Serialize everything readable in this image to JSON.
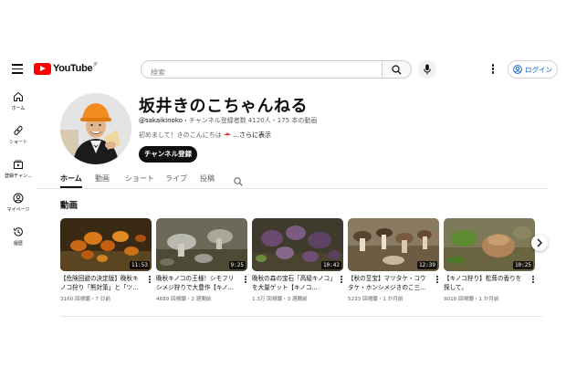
{
  "header": {
    "logo_text": "YouTube",
    "logo_region": "JP",
    "search_placeholder": "検索",
    "login_label": "ログイン"
  },
  "sidebar": {
    "items": [
      {
        "label": "ホーム",
        "icon": "home-icon"
      },
      {
        "label": "ショート",
        "icon": "shorts-icon"
      },
      {
        "label": "登録チャン...",
        "icon": "subscriptions-icon"
      },
      {
        "label": "マイページ",
        "icon": "you-icon"
      },
      {
        "label": "履歴",
        "icon": "history-icon"
      }
    ]
  },
  "channel": {
    "name": "坂井きのこちゃんねる",
    "handle": "@sakaikinoko",
    "meta_rest": "・チャンネル登録者数 4120人・175 本の動画",
    "description": "初めまして！きのこんにちは",
    "description_more": "...さらに表示",
    "subscribe_label": "チャンネル登録"
  },
  "tabs": [
    {
      "label": "ホーム",
      "active": true
    },
    {
      "label": "動画",
      "active": false
    },
    {
      "label": "ショート",
      "active": false
    },
    {
      "label": "ライブ",
      "active": false
    },
    {
      "label": "投稿",
      "active": false
    }
  ],
  "section": {
    "title": "動画"
  },
  "videos": [
    {
      "title": "【危険回避の決定版】晩秋キノコ狩り「熊対策」と「ツ...",
      "duration": "11:53",
      "meta": "3160 回視聴・7 日前"
    },
    {
      "title": "晩秋キノコの王様！シモフリシメジ狩りで大豊作【キノ...",
      "duration": "9:25",
      "meta": "4689 回視聴・2 週間前"
    },
    {
      "title": "晩秋の森の宝石「高級キノコ」を大量ゲット【キノコ...",
      "duration": "10:42",
      "meta": "1.3万 回視聴・3 週間前"
    },
    {
      "title": "【秋の至宝】マツタケ・コウタケ・ホンシメジきのこ三...",
      "duration": "12:39",
      "meta": "5233 回視聴・1 か月前"
    },
    {
      "title": "【キノコ狩り】松茸の香りを探して。",
      "duration": "10:25",
      "meta": "9018 回視聴・1 か月前"
    }
  ],
  "colors": {
    "brand_red": "#ff0000",
    "link_blue": "#065fd4",
    "text_primary": "#0f0f0f",
    "text_secondary": "#606060"
  }
}
